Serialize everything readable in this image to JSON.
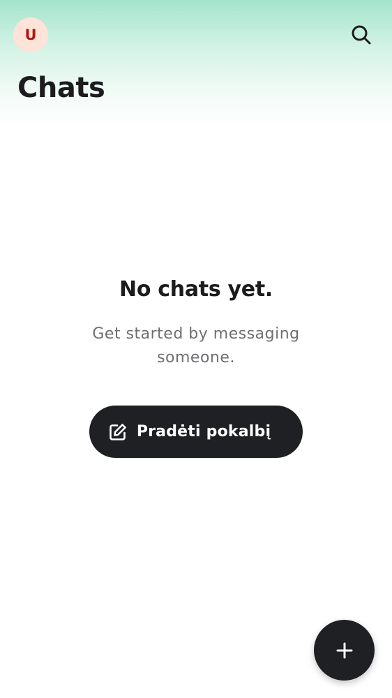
{
  "header": {
    "avatar_initial": "U",
    "title": "Chats",
    "search_icon": "search-icon"
  },
  "empty_state": {
    "title": "No chats yet.",
    "subtitle": "Get started by messaging someone.",
    "button_label": "Pradėti pokalbį",
    "button_icon": "edit-icon"
  },
  "fab": {
    "icon": "plus-icon"
  },
  "colors": {
    "accent_gradient_top": "#a4e4cb",
    "avatar_bg": "#fde3d8",
    "avatar_text": "#b0180f",
    "button_bg": "#1f2023",
    "text_primary": "#1c1c1e",
    "text_secondary": "#6e6e73"
  }
}
